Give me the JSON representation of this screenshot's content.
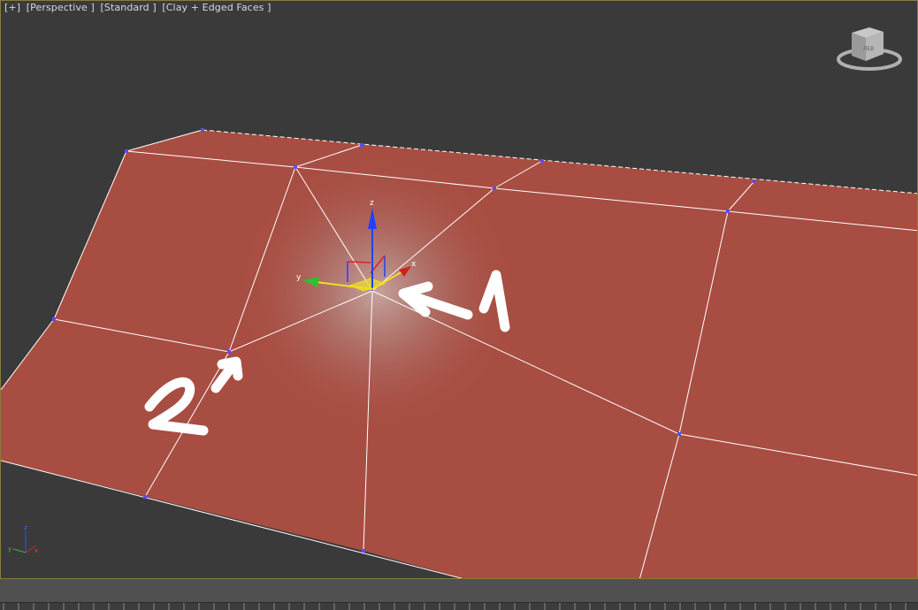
{
  "viewport": {
    "label_plus": "[+]",
    "label_view": "[Perspective ]",
    "label_shading_standard": "[Standard ]",
    "label_shading_mode": "[Clay + Edged Faces ]"
  },
  "annotations": {
    "arrow1_label": "1",
    "arrow2_label": "2"
  },
  "gizmo": {
    "axis_x": "x",
    "axis_y": "y",
    "axis_z": "z"
  },
  "viewcube": {
    "face_label": "ЛЕВ"
  },
  "colors": {
    "viewport_bg": "#3a3a3a",
    "clay": "#a84d42",
    "edge": "#ffffff",
    "vertex": "#4b3cff",
    "axis_x": "#e02020",
    "axis_y": "#30c030",
    "axis_z": "#2040ff",
    "selection": "#f0e020"
  }
}
